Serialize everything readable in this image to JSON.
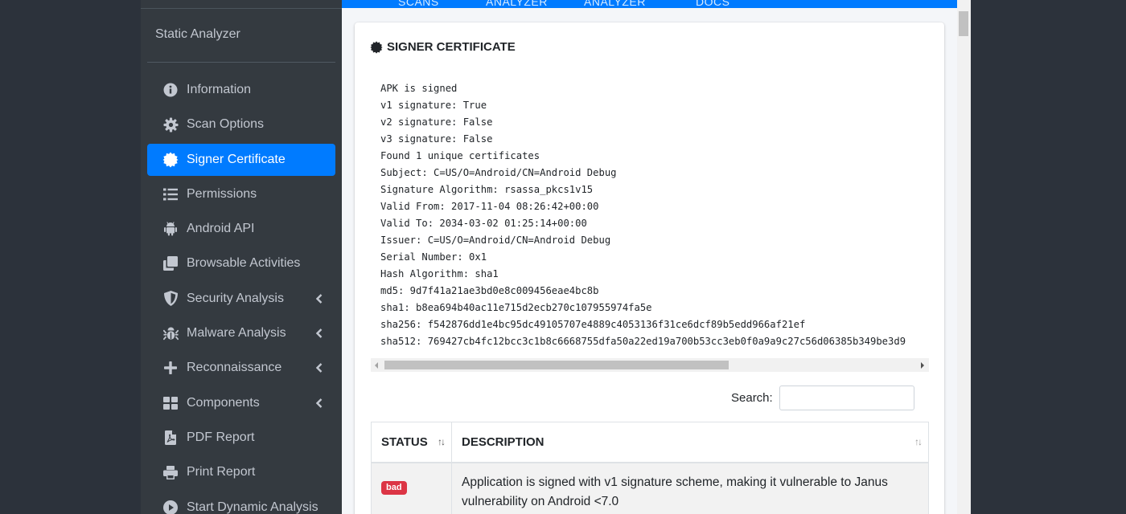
{
  "sidebar": {
    "brand": "Static Analyzer",
    "items": [
      {
        "label": "Information",
        "icon": "info-circle-icon"
      },
      {
        "label": "Scan Options",
        "icon": "gear-icon"
      },
      {
        "label": "Signer Certificate",
        "icon": "certificate-icon",
        "active": true
      },
      {
        "label": "Permissions",
        "icon": "list-icon"
      },
      {
        "label": "Android API",
        "icon": "android-icon"
      },
      {
        "label": "Browsable Activities",
        "icon": "clone-icon"
      },
      {
        "label": "Security Analysis",
        "icon": "shield-icon",
        "expandable": true
      },
      {
        "label": "Malware Analysis",
        "icon": "bug-icon",
        "expandable": true
      },
      {
        "label": "Reconnaissance",
        "icon": "plus-icon",
        "expandable": true
      },
      {
        "label": "Components",
        "icon": "grid-icon",
        "expandable": true
      },
      {
        "label": "PDF Report",
        "icon": "pdf-file-icon"
      },
      {
        "label": "Print Report",
        "icon": "printer-icon"
      },
      {
        "label": "Start Dynamic Analysis",
        "icon": "play-icon"
      }
    ]
  },
  "topnav": {
    "items": [
      "SCANS",
      "ANALYZER",
      "ANALYZER",
      "DOCS"
    ]
  },
  "card": {
    "title": "SIGNER CERTIFICATE",
    "certificate_text": "APK is signed\nv1 signature: True\nv2 signature: False\nv3 signature: False\nFound 1 unique certificates\nSubject: C=US/O=Android/CN=Android Debug\nSignature Algorithm: rsassa_pkcs1v15\nValid From: 2017-11-04 08:26:42+00:00\nValid To: 2034-03-02 01:25:14+00:00\nIssuer: C=US/O=Android/CN=Android Debug\nSerial Number: 0x1\nHash Algorithm: sha1\nmd5: 9d7f41a21ae3bd0e8c009456eae4bc8b\nsha1: b8ea694b40ac11e715d2ecb270c107955974fa5e\nsha256: f542876dd1e4bc95dc49105707e4889c4053136f31ce6dcf89b5edd966af21ef\nsha512: 769427cb4fc12bcc3c1b8c6668755dfa50a22ed19a700b53cc3eb0f0a9a9c27c56d06385b349be3d9"
  },
  "search": {
    "label": "Search:",
    "value": ""
  },
  "table": {
    "headers": [
      "STATUS",
      "DESCRIPTION"
    ],
    "rows": [
      {
        "status": "bad",
        "description": "Application is signed with v1 signature scheme, making it vulnerable to Janus vulnerability on Android <7.0"
      }
    ]
  },
  "colors": {
    "accent": "#007bff",
    "sidebar_bg": "#343a40",
    "badge_bad": "#dc3545"
  }
}
